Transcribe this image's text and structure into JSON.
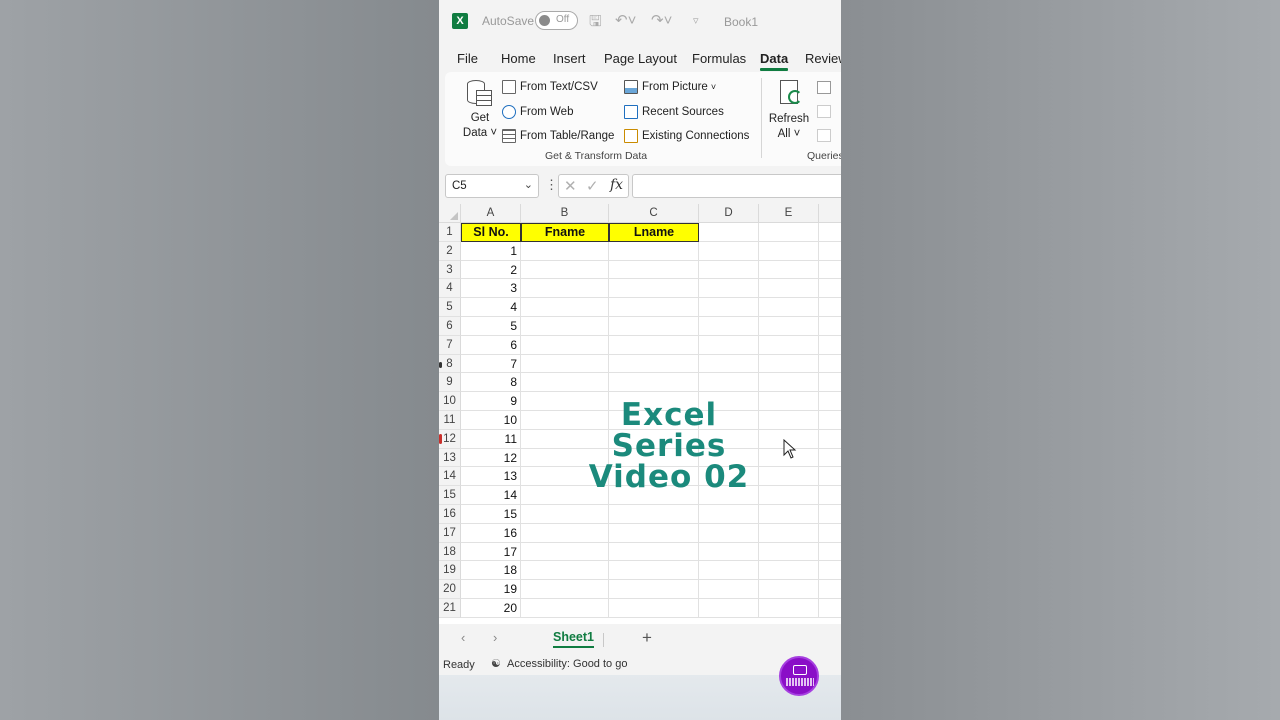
{
  "titlebar": {
    "autosave_label": "AutoSave",
    "autosave_state": "Off",
    "workbook_title": "Book1"
  },
  "tabs": [
    "File",
    "Home",
    "Insert",
    "Page Layout",
    "Formulas",
    "Data",
    "Review"
  ],
  "active_tab": "Data",
  "ribbon": {
    "get_data_line1": "Get",
    "get_data_line2": "Data",
    "from_text_csv": "From Text/CSV",
    "from_web": "From Web",
    "from_table_range": "From Table/Range",
    "from_picture": "From Picture",
    "recent_sources": "Recent Sources",
    "existing_connections": "Existing Connections",
    "group_label": "Get & Transform Data",
    "refresh_line1": "Refresh",
    "refresh_line2": "All",
    "queries_partial": "Queries"
  },
  "formula_bar": {
    "name_box": "C5",
    "fx": "fx",
    "formula": ""
  },
  "grid": {
    "columns": [
      "A",
      "B",
      "C",
      "D",
      "E"
    ],
    "rows": [
      "1",
      "2",
      "3",
      "4",
      "5",
      "6",
      "7",
      "8",
      "9",
      "10",
      "11",
      "12",
      "13",
      "14",
      "15",
      "16",
      "17",
      "18",
      "19",
      "20",
      "21"
    ],
    "header_cells": [
      "Sl No.",
      "Fname",
      "Lname"
    ],
    "sl_values": [
      "1",
      "2",
      "3",
      "4",
      "5",
      "6",
      "7",
      "8",
      "9",
      "10",
      "11",
      "12",
      "13",
      "14",
      "15",
      "16",
      "17",
      "18",
      "19",
      "20"
    ]
  },
  "overlay_text": [
    "Excel",
    "Series",
    "Video  02"
  ],
  "sheets": {
    "active": "Sheet1"
  },
  "status": {
    "ready": "Ready",
    "accessibility": "Accessibility: Good to go"
  },
  "colors": {
    "excel_green": "#107c41",
    "header_fill": "#ffff00",
    "overlay_teal": "#1b8a7c",
    "watermark_purple": "#8a0ec7"
  }
}
